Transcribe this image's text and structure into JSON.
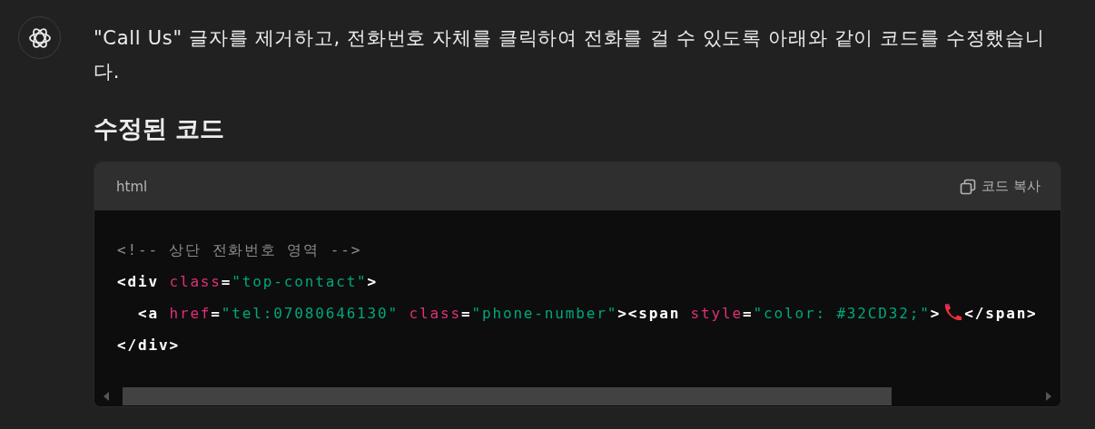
{
  "message": {
    "paragraph": "\"Call Us\" 글자를 제거하고, 전화번호 자체를 클릭하여 전화를 걸 수 있도록 아래와 같이 코드를 수정했습니다.",
    "heading": "수정된 코드"
  },
  "code_block": {
    "language": "html",
    "copy_label": "코드 복사",
    "lines": [
      [
        {
          "kind": "comment",
          "text": "<!-- 상단 전화번호 영역 -->"
        }
      ],
      [
        {
          "kind": "tag",
          "text": "<div "
        },
        {
          "kind": "attr",
          "text": "class"
        },
        {
          "kind": "tag",
          "text": "="
        },
        {
          "kind": "string",
          "text": "\"top-contact\""
        },
        {
          "kind": "tag",
          "text": ">"
        }
      ],
      [
        {
          "kind": "tag",
          "text": "  <a "
        },
        {
          "kind": "attr",
          "text": "href"
        },
        {
          "kind": "tag",
          "text": "="
        },
        {
          "kind": "string",
          "text": "\"tel:07080646130\" "
        },
        {
          "kind": "attr",
          "text": "class"
        },
        {
          "kind": "tag",
          "text": "="
        },
        {
          "kind": "string",
          "text": "\"phone-number\""
        },
        {
          "kind": "tag",
          "text": "><span "
        },
        {
          "kind": "attr",
          "text": "style"
        },
        {
          "kind": "tag",
          "text": "="
        },
        {
          "kind": "string",
          "text": "\"color: #32CD32;\""
        },
        {
          "kind": "tag",
          "text": ">"
        },
        {
          "kind": "phone_icon"
        },
        {
          "kind": "tag",
          "text": "</span>"
        }
      ],
      [
        {
          "kind": "tag",
          "text": "</div>"
        }
      ]
    ]
  }
}
